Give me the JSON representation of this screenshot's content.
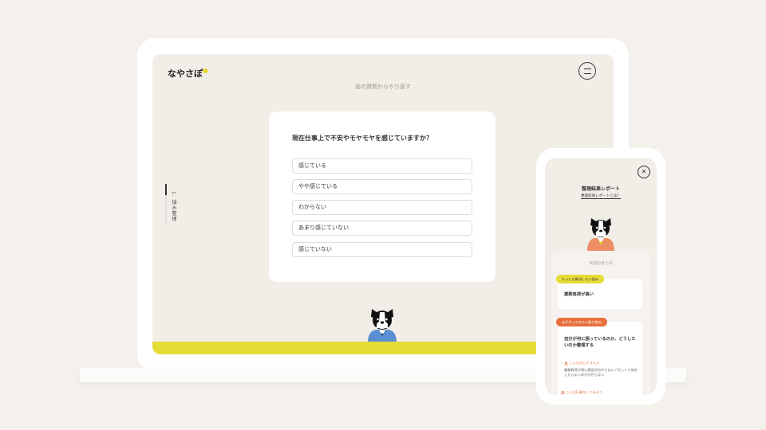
{
  "laptop": {
    "logo": "なやさぽ",
    "back_link": "前の質問からやり直す",
    "progress_label": "1. 悩み整理",
    "question": "現在仕事上で不安やモヤモヤを感じていますか？",
    "options": [
      "感じている",
      "やや感じている",
      "わからない",
      "あまり感じていない",
      "感じていない"
    ]
  },
  "phone": {
    "title": "整理結果レポート",
    "link": "整理結果レポートとは？",
    "summary_heading": "今回のまとめ",
    "tag1": "もっとも解決したい悩み",
    "box1_text": "業務負荷が高い",
    "tag2": "まずやってみたい取り組み",
    "box2_text": "自分が何に困っているのか、どうしたいのか整理する",
    "recommend_label": "こんな方にオススメ",
    "recommend_text": "業務負荷が高い原因が分からない / 忙しくて何をしたらよいのか分からない",
    "action_label": "こんな行動をしてみよう"
  },
  "colors": {
    "accent_yellow": "#e6dc37",
    "accent_orange": "#e8703e",
    "background": "#f1ede7"
  },
  "icons": [
    "menu-icon",
    "close-icon",
    "person-icon",
    "flag-icon"
  ]
}
